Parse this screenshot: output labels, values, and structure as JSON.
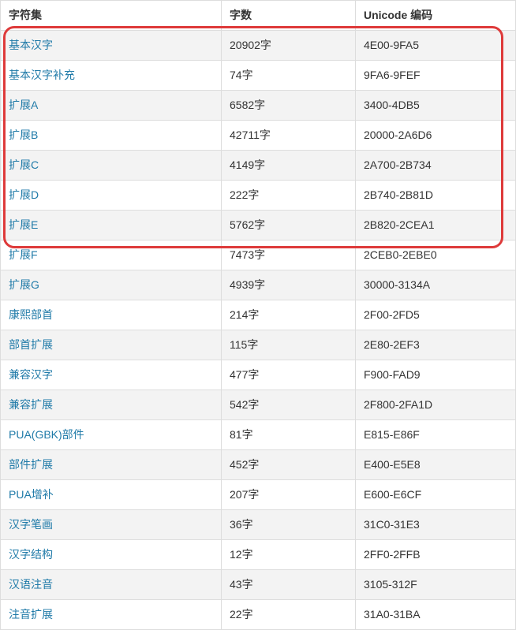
{
  "headers": {
    "charset": "字符集",
    "count": "字数",
    "code": "Unicode 编码"
  },
  "rows": [
    {
      "name": "基本汉字",
      "count": "20902字",
      "code": "4E00-9FA5",
      "highlighted": true
    },
    {
      "name": "基本汉字补充",
      "count": "74字",
      "code": "9FA6-9FEF",
      "highlighted": true
    },
    {
      "name": "扩展A",
      "count": "6582字",
      "code": "3400-4DB5",
      "highlighted": true
    },
    {
      "name": "扩展B",
      "count": "42711字",
      "code": "20000-2A6D6",
      "highlighted": true
    },
    {
      "name": "扩展C",
      "count": "4149字",
      "code": "2A700-2B734",
      "highlighted": true
    },
    {
      "name": "扩展D",
      "count": "222字",
      "code": "2B740-2B81D",
      "highlighted": true
    },
    {
      "name": "扩展E",
      "count": "5762字",
      "code": "2B820-2CEA1",
      "highlighted": true
    },
    {
      "name": "扩展F",
      "count": "7473字",
      "code": "2CEB0-2EBE0",
      "highlighted": true
    },
    {
      "name": "扩展G",
      "count": "4939字",
      "code": "30000-3134A",
      "highlighted": true
    },
    {
      "name": "康熙部首",
      "count": "214字",
      "code": "2F00-2FD5",
      "highlighted": false
    },
    {
      "name": "部首扩展",
      "count": "115字",
      "code": "2E80-2EF3",
      "highlighted": false
    },
    {
      "name": "兼容汉字",
      "count": "477字",
      "code": "F900-FAD9",
      "highlighted": false
    },
    {
      "name": "兼容扩展",
      "count": "542字",
      "code": "2F800-2FA1D",
      "highlighted": false
    },
    {
      "name": "PUA(GBK)部件",
      "count": "81字",
      "code": "E815-E86F",
      "highlighted": false
    },
    {
      "name": "部件扩展",
      "count": "452字",
      "code": "E400-E5E8",
      "highlighted": false
    },
    {
      "name": "PUA增补",
      "count": "207字",
      "code": "E600-E6CF",
      "highlighted": false
    },
    {
      "name": "汉字笔画",
      "count": "36字",
      "code": "31C0-31E3",
      "highlighted": false
    },
    {
      "name": "汉字结构",
      "count": "12字",
      "code": "2FF0-2FFB",
      "highlighted": false
    },
    {
      "name": "汉语注音",
      "count": "43字",
      "code": "3105-312F",
      "highlighted": false
    },
    {
      "name": "注音扩展",
      "count": "22字",
      "code": "31A0-31BA",
      "highlighted": false
    }
  ],
  "annotation": {
    "highlight_color": "#de3a3a"
  }
}
